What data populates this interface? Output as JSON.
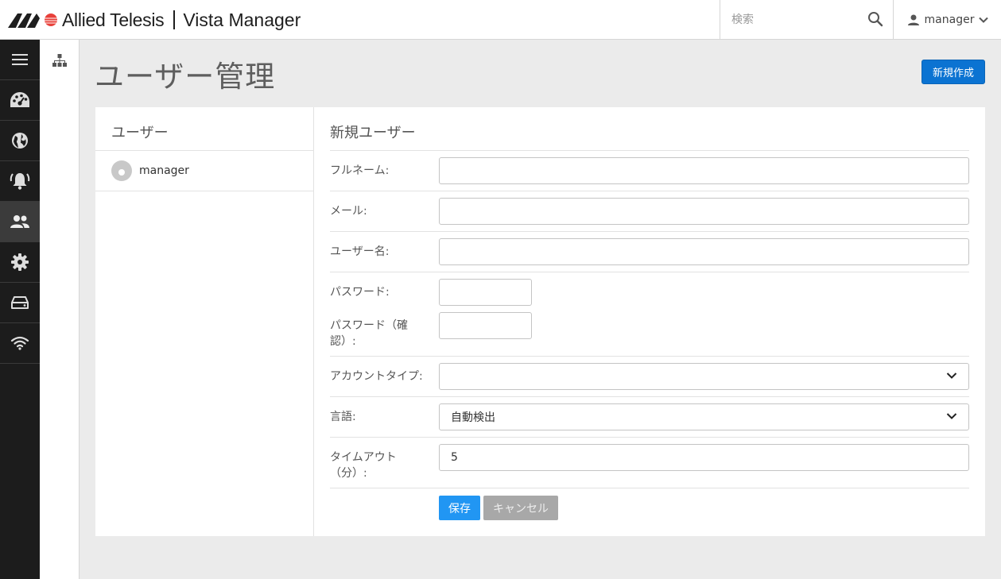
{
  "header": {
    "brand": "Allied Telesis",
    "product": "Vista Manager",
    "search_placeholder": "検索",
    "user_name": "manager",
    "icons": [
      "logo-icon",
      "search-icon",
      "user-icon",
      "chevron-down-icon"
    ]
  },
  "sidebar": {
    "items": [
      {
        "icon": "menu-icon"
      },
      {
        "icon": "dashboard-icon"
      },
      {
        "icon": "globe-icon"
      },
      {
        "icon": "alarm-bell-icon"
      },
      {
        "icon": "users-icon",
        "active": true
      },
      {
        "icon": "gear-icon"
      },
      {
        "icon": "storage-icon"
      },
      {
        "icon": "wifi-icon"
      }
    ],
    "sub_icon": "network-tree-icon"
  },
  "main": {
    "title": "ユーザー管理",
    "new_button": "新規作成"
  },
  "user_list": {
    "title": "ユーザー",
    "users": [
      {
        "name": "manager"
      }
    ]
  },
  "form": {
    "title": "新規ユーザー",
    "fullname_label": "フルネーム:",
    "fullname_value": "",
    "email_label": "メール:",
    "email_value": "",
    "username_label": "ユーザー名:",
    "username_value": "",
    "password_label": "パスワード:",
    "password_confirm_label_1": "パスワード（確",
    "password_confirm_label_2": "認）:",
    "account_type_label": "アカウントタイプ:",
    "account_type_value": "",
    "language_label": "言語:",
    "language_value": "自動検出",
    "timeout_label_1": "タイムアウト",
    "timeout_label_2": "（分）:",
    "timeout_value": "5",
    "save_button": "保存",
    "cancel_button": "キャンセル"
  },
  "colors": {
    "sidebar_bg": "#1c1c1c",
    "primary_button": "#0b73d2",
    "save_button": "#2196f3",
    "cancel_button": "#a8a8a8",
    "logo_red": "#e8403a"
  }
}
